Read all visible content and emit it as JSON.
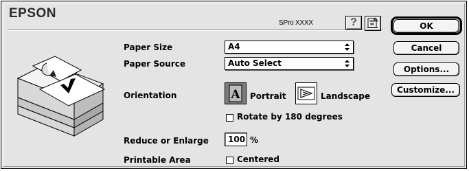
{
  "window": {
    "brand": "EPSON",
    "model": "SPro XXXX"
  },
  "header": {
    "help_icon_glyph": "?",
    "help_icon": "help-icon",
    "utility_icon": "printer-utility-icon"
  },
  "buttons": {
    "ok": "OK",
    "cancel": "Cancel",
    "options": "Options...",
    "customize": "Customize..."
  },
  "fields": {
    "paper_size": {
      "label": "Paper Size",
      "value": "A4"
    },
    "paper_source": {
      "label": "Paper Source",
      "value": "Auto Select"
    },
    "orientation": {
      "label": "Orientation",
      "options": [
        "Portrait",
        "Landscape"
      ],
      "selected": "Portrait",
      "portrait_glyph": "A"
    },
    "rotate": {
      "label": "Rotate by 180 degrees",
      "checked": false
    },
    "reduce_enlarge": {
      "label": "Reduce or Enlarge",
      "value": "100",
      "unit": "%"
    },
    "printable_area": {
      "label": "Printable Area",
      "option": "Centered",
      "checked": false
    }
  },
  "colors": {
    "dialog_bg": "#e4e4e4",
    "portrait_selected_bg": "#7a7a7a"
  }
}
